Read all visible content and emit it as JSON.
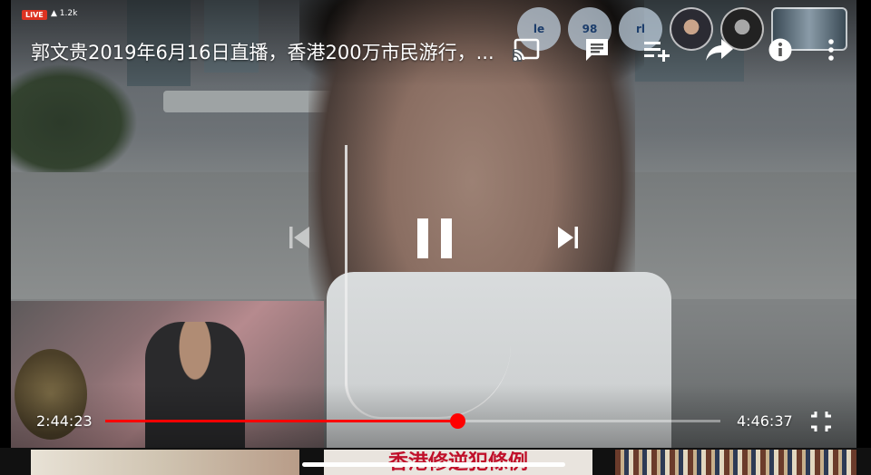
{
  "player": {
    "live_label": "LIVE",
    "viewer_count": "1.2k",
    "title": "郭文贵2019年6月16日直播，香港200万市民游行，...",
    "elapsed": "2:44:23",
    "duration": "4:46:37",
    "progress": 0.572
  },
  "top_avatars": [
    "le",
    "98",
    "rl"
  ],
  "icons": {
    "cast": "cast-icon",
    "chat": "chat-icon",
    "playlist_add": "playlist-add-icon",
    "share": "share-icon",
    "info": "info-icon",
    "more": "more-vert-icon",
    "prev": "skip-previous-icon",
    "pause": "pause-icon",
    "next": "skip-next-icon",
    "fullscreen_exit": "fullscreen-exit-icon"
  },
  "thumbnails": {
    "middle_text": "香港修逆犯條例"
  },
  "colors": {
    "accent": "#ff0000",
    "live": "#dd3322"
  }
}
